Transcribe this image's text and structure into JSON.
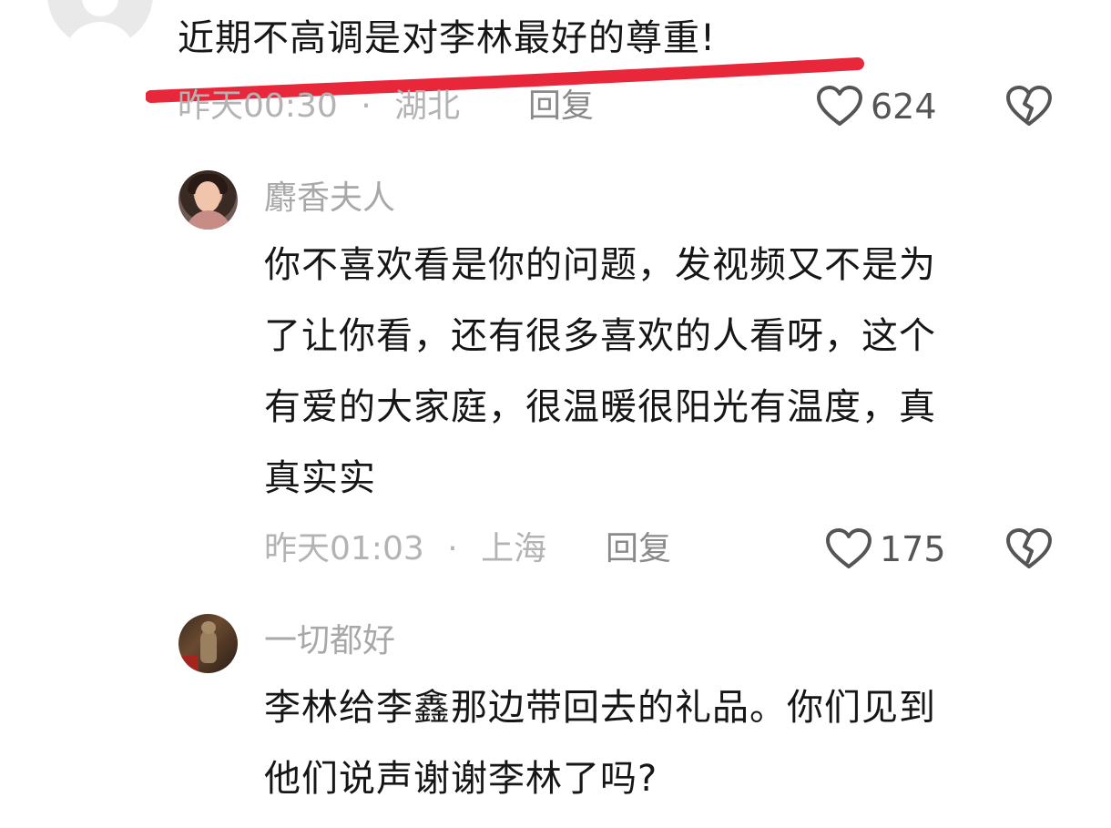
{
  "comments": [
    {
      "text": "近期不高调是对李林最好的尊重!",
      "time": "昨天00:30",
      "location": "湖北",
      "reply_label": "回复",
      "likes": "624"
    },
    {
      "username": "麝香夫人",
      "lines": [
        "你不喜欢看是你的问题，发视频又不是为",
        "了让你看，还有很多喜欢的人看呀，这个",
        "有爱的大家庭，很温暖很阳光有温度，真",
        "真实实"
      ],
      "time": "昨天01:03",
      "location": "上海",
      "reply_label": "回复",
      "likes": "175"
    },
    {
      "username": "一切都好",
      "lines": [
        "李林给李鑫那边带回去的礼品。你们见到",
        "他们说声谢谢李林了吗?"
      ]
    }
  ],
  "separator": "·",
  "colors": {
    "underline": "#e8283a",
    "meta": "#b3b3b3",
    "text": "#161616"
  },
  "icons": {
    "like": "heart-outline-icon",
    "dislike": "broken-heart-icon"
  }
}
